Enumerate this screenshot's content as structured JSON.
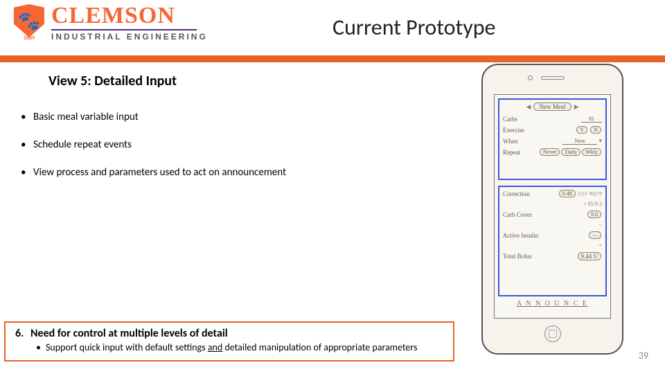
{
  "header": {
    "university": "CLEMSON",
    "year": "1889",
    "department": "INDUSTRIAL ENGINEERING",
    "paw_glyph": "🐾"
  },
  "slide": {
    "title": "Current Prototype",
    "section": "View 5: Detailed Input",
    "bullets": [
      "Basic meal variable input",
      "Schedule repeat events",
      "View process and parameters used to act on announcement"
    ],
    "page_number": "39"
  },
  "phone_sketch": {
    "title_pill": "New Meal",
    "upper": {
      "rows": [
        {
          "label": "Carbs",
          "fields": [
            "81"
          ]
        },
        {
          "label": "Exercise",
          "fields": [
            "Y",
            "N"
          ]
        },
        {
          "label": "When",
          "fields": [
            "Now"
          ]
        },
        {
          "label": "Repeat",
          "fields": [
            "Never",
            "Daily",
            "Wkly"
          ]
        }
      ]
    },
    "lower": {
      "rows": [
        {
          "label": "Correction",
          "value": "0.48",
          "note": "(123−90)/70"
        },
        {
          "label": "Carb Cover",
          "value": "9.0",
          "note": "+ 85/9.3"
        },
        {
          "label": "Active Insulin",
          "value": "—",
          "note": "−"
        },
        {
          "label": "Total Bolus",
          "value": "9.44 U",
          "note": "="
        }
      ]
    },
    "announce": "A N N O U N C E"
  },
  "callout": {
    "number": "6.",
    "heading": "Need for control at multiple levels of detail",
    "sub_pre": "Support quick input with default settings ",
    "sub_and": "and",
    "sub_post": " detailed manipulation of appropriate parameters"
  }
}
